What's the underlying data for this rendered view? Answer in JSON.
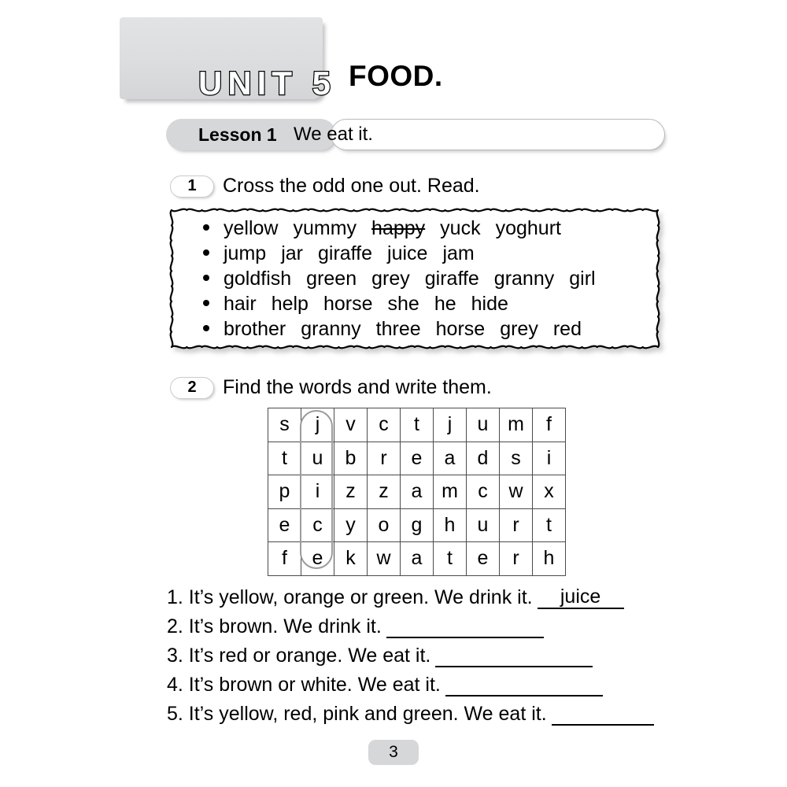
{
  "unit": {
    "title": "UNIT 5",
    "subject": "FOOD."
  },
  "lesson": {
    "label": "Lesson 1",
    "topic": "We eat it."
  },
  "exercise1": {
    "number": "1",
    "instruction": "Cross the odd one out. Read.",
    "rows": [
      {
        "words": [
          "yellow",
          "yummy",
          "happy",
          "yuck",
          "yoghurt"
        ],
        "struck": "happy"
      },
      {
        "words": [
          "jump",
          "jar",
          "giraffe",
          "juice",
          "jam"
        ],
        "struck": null
      },
      {
        "words": [
          "goldfish",
          "green",
          "grey",
          "giraffe",
          "granny",
          "girl"
        ],
        "struck": null
      },
      {
        "words": [
          "hair",
          "help",
          "horse",
          "she",
          "he",
          "hide"
        ],
        "struck": null
      },
      {
        "words": [
          "brother",
          "granny",
          "three",
          "horse",
          "grey",
          "red"
        ],
        "struck": null
      }
    ]
  },
  "exercise2": {
    "number": "2",
    "instruction": "Find the words and write them.",
    "grid": [
      [
        "s",
        "j",
        "v",
        "c",
        "t",
        "j",
        "u",
        "m",
        "f"
      ],
      [
        "t",
        "u",
        "b",
        "r",
        "e",
        "a",
        "d",
        "s",
        "i"
      ],
      [
        "p",
        "i",
        "z",
        "z",
        "a",
        "m",
        "c",
        "w",
        "x"
      ],
      [
        "e",
        "c",
        "y",
        "o",
        "g",
        "h",
        "u",
        "r",
        "t"
      ],
      [
        "f",
        "e",
        "k",
        "w",
        "a",
        "t",
        "e",
        "r",
        "h"
      ]
    ],
    "highlighted_word": "juice",
    "highlight_column": 1,
    "questions": [
      {
        "number": "1.",
        "text": "It’s yellow, orange or green. We drink it.",
        "answer": "juice",
        "blank_width": 110
      },
      {
        "number": "2.",
        "text": "It’s brown. We drink it.",
        "answer": "",
        "blank_width": 200
      },
      {
        "number": "3.",
        "text": "It’s red or orange. We eat it.",
        "answer": "",
        "blank_width": 200
      },
      {
        "number": "4.",
        "text": "It’s brown or white. We eat it.",
        "answer": "",
        "blank_width": 200
      },
      {
        "number": "5.",
        "text": "It’s yellow, red, pink and green. We eat it.",
        "answer": "",
        "blank_width": 130
      }
    ]
  },
  "page_number": "3"
}
